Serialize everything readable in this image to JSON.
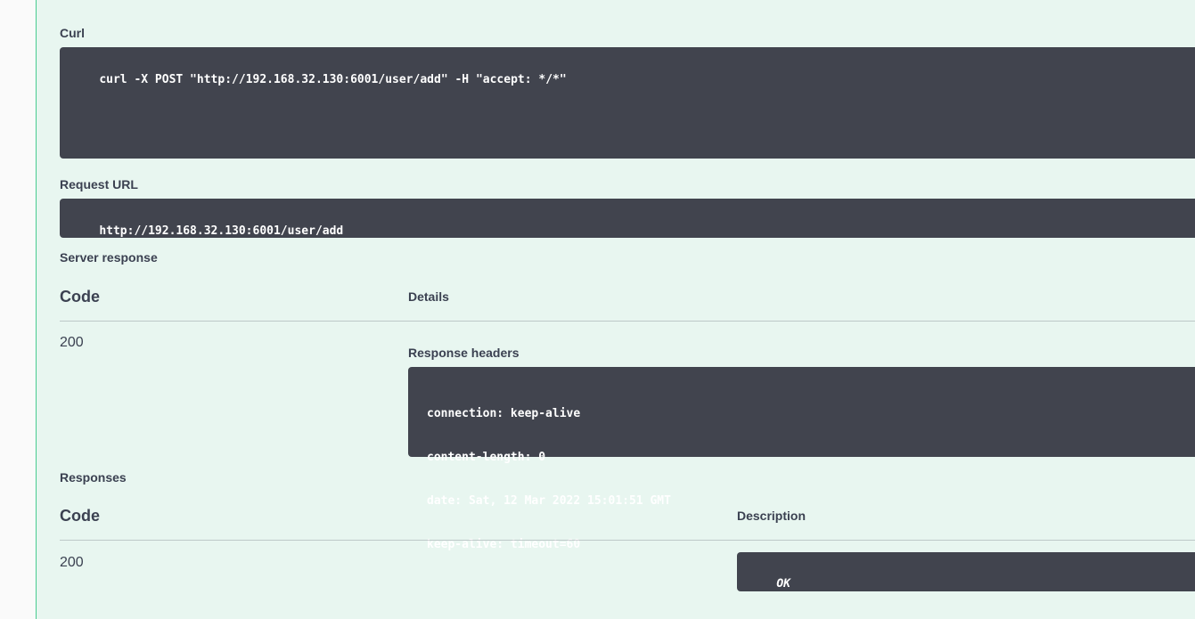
{
  "curl": {
    "label": "Curl",
    "command": "curl -X POST \"http://192.168.32.130:6001/user/add\" -H \"accept: */*\""
  },
  "request_url": {
    "label": "Request URL",
    "value": "http://192.168.32.130:6001/user/add"
  },
  "server_response": {
    "label": "Server response",
    "code_header": "Code",
    "details_header": "Details",
    "code": "200",
    "headers_label": "Response headers",
    "headers": [
      "connection: keep-alive",
      "content-length: 0",
      "date: Sat, 12 Mar 2022 15:01:51 GMT",
      "keep-alive: timeout=60"
    ]
  },
  "responses": {
    "label": "Responses",
    "code_header": "Code",
    "description_header": "Description",
    "code": "200",
    "description": "OK"
  }
}
